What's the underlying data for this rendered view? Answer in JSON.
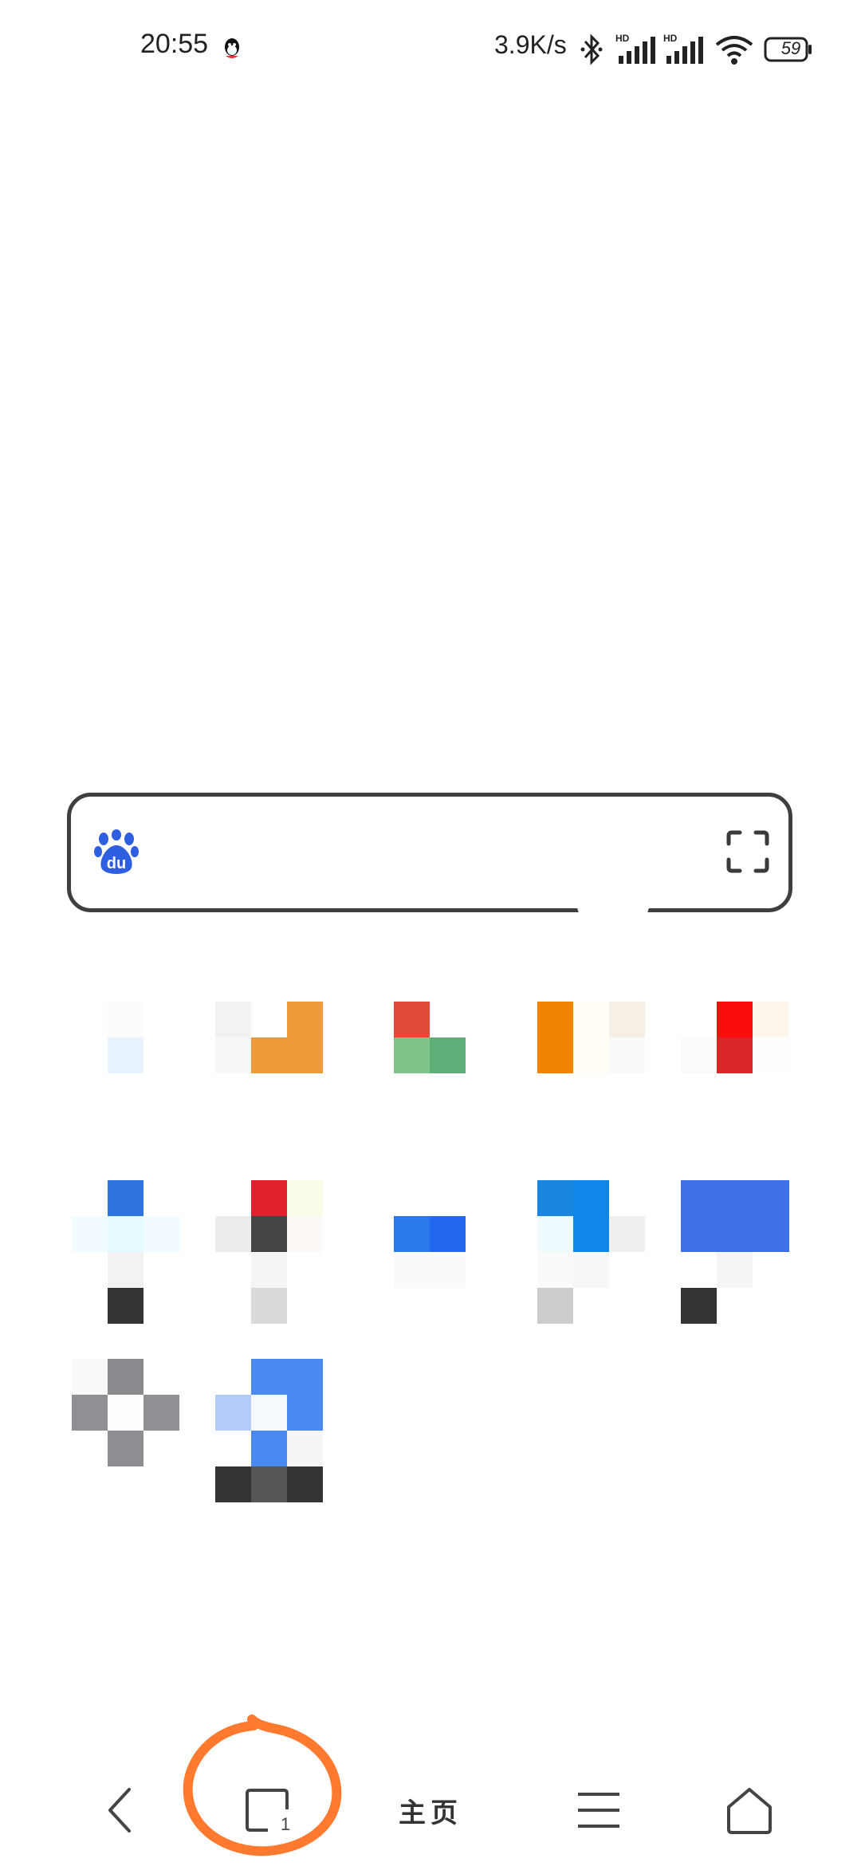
{
  "status_bar": {
    "time": "20:55",
    "network_speed": "3.9K/s",
    "battery": "59",
    "icons": [
      "qq-icon",
      "bluetooth-icon",
      "signal-hd-icon",
      "signal-hd-icon",
      "wifi-icon",
      "battery-icon"
    ]
  },
  "search": {
    "logo_icon": "baidu-paw-icon",
    "scan_icon": "scan-frame-icon"
  },
  "bottom_nav": {
    "back_icon": "chevron-left-icon",
    "tabs_count": "1",
    "home_label": "主页",
    "menu_icon": "hamburger-icon",
    "house_icon": "home-icon"
  },
  "colors": {
    "annotation": "#ff7a2e",
    "baidu_blue": "#2d5fe0"
  }
}
